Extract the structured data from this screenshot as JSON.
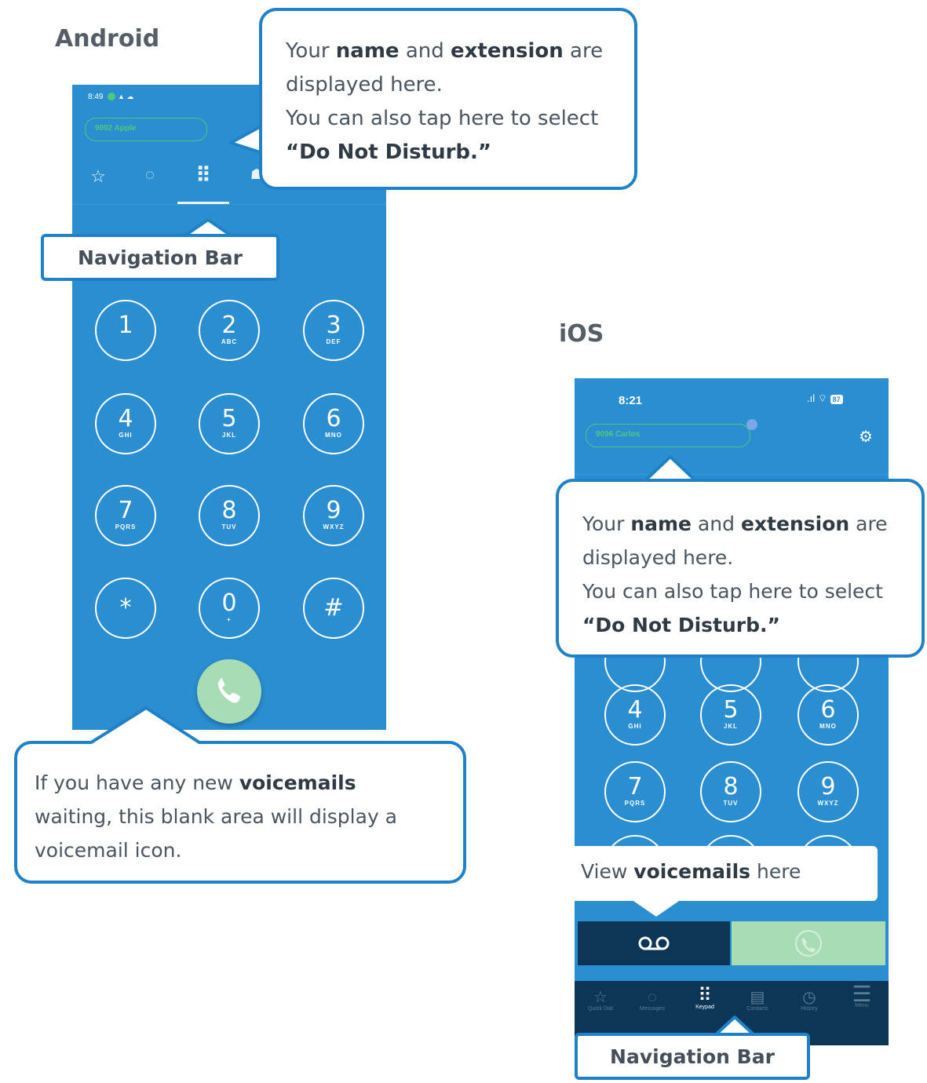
{
  "android": {
    "heading": "Android",
    "status_time": "8:49",
    "user_pill": "9002 Apple",
    "nav_icons": [
      "star-icon",
      "chat-icon",
      "keypad-icon",
      "contacts-icon"
    ],
    "nav_label": "Navigation Bar",
    "keypad": [
      {
        "digit": "1",
        "letters": ""
      },
      {
        "digit": "2",
        "letters": "ABC"
      },
      {
        "digit": "3",
        "letters": "DEF"
      },
      {
        "digit": "4",
        "letters": "GHI"
      },
      {
        "digit": "5",
        "letters": "JKL"
      },
      {
        "digit": "6",
        "letters": "MNO"
      },
      {
        "digit": "7",
        "letters": "PQRS"
      },
      {
        "digit": "8",
        "letters": "TUV"
      },
      {
        "digit": "9",
        "letters": "WXYZ"
      },
      {
        "digit": "*",
        "letters": ""
      },
      {
        "digit": "0",
        "letters": "+"
      },
      {
        "digit": "#",
        "letters": ""
      }
    ],
    "callout_name": {
      "l1_pre": "Your ",
      "l1_b1": "name",
      "l1_mid": " and ",
      "l1_b2": "extension",
      "l1_post": " are",
      "l2": "displayed here.",
      "l3": "You can also tap here to select",
      "l4": "“Do Not Disturb.”"
    },
    "callout_voicemail": {
      "l1_pre": "If you have any new ",
      "l1_b": "voicemails",
      "l2": "waiting, this blank area will display a",
      "l3": "voicemail icon."
    }
  },
  "ios": {
    "heading": "iOS",
    "status_time": "8:21",
    "battery": "87",
    "user_pill": "9096 Carlos",
    "keypad_visible": [
      {
        "digit": "4",
        "letters": "GHI"
      },
      {
        "digit": "5",
        "letters": "JKL"
      },
      {
        "digit": "6",
        "letters": "MNO"
      },
      {
        "digit": "7",
        "letters": "PQRS"
      },
      {
        "digit": "8",
        "letters": "TUV"
      },
      {
        "digit": "9",
        "letters": "WXYZ"
      }
    ],
    "callout_name": {
      "l1_pre": "Your ",
      "l1_b1": "name",
      "l1_mid": " and ",
      "l1_b2": "extension",
      "l1_post": " are",
      "l2": "displayed here.",
      "l3": "You can also tap here to select",
      "l4": "“Do Not Disturb.”"
    },
    "callout_voicemail": {
      "pre": "View ",
      "b": "voicemails",
      "post": " here"
    },
    "tabs": [
      {
        "icon": "☆",
        "label": "Quick Dial"
      },
      {
        "icon": "◌",
        "label": "Messages"
      },
      {
        "icon": "⠿",
        "label": "Keypad"
      },
      {
        "icon": "▤",
        "label": "Contacts"
      },
      {
        "icon": "◷",
        "label": "History"
      },
      {
        "icon": "☰",
        "label": "Menu"
      }
    ],
    "nav_label": "Navigation Bar"
  },
  "colors": {
    "phone_blue": "#2a8ed0",
    "callout_border": "#1f82c9",
    "call_green": "#a8dcb4",
    "ios_dark": "#0c3556",
    "status_green": "#4ec97c"
  }
}
